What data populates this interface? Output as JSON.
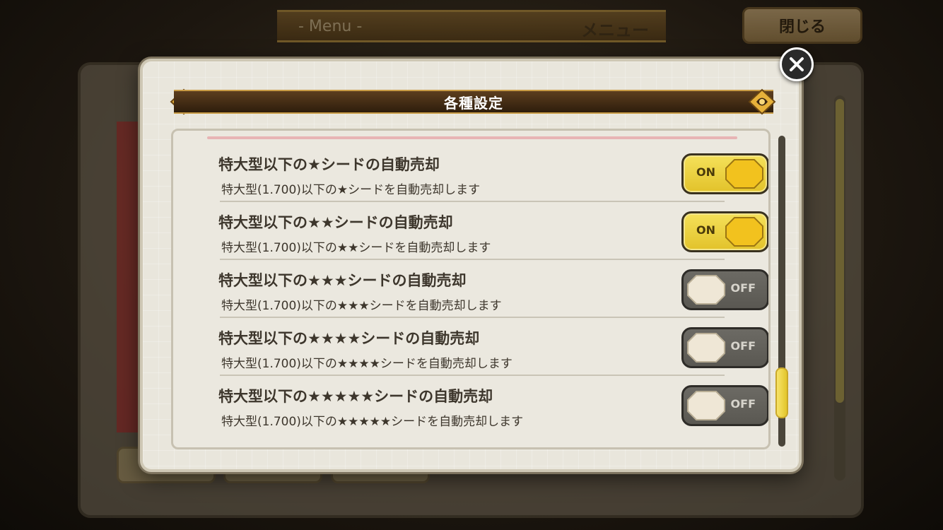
{
  "background": {
    "header_en": "- Menu -",
    "header_jp": "メニュー",
    "close_button_label": "閉じる"
  },
  "dialog": {
    "title": "各種設定",
    "close_icon": "close-icon",
    "settings": [
      {
        "title": "特大型以下の★シードの自動売却",
        "description": "特大型(1.700)以下の★シードを自動売却します",
        "state": "ON"
      },
      {
        "title": "特大型以下の★★シードの自動売却",
        "description": "特大型(1.700)以下の★★シードを自動売却します",
        "state": "ON"
      },
      {
        "title": "特大型以下の★★★シードの自動売却",
        "description": "特大型(1.700)以下の★★★シードを自動売却します",
        "state": "OFF"
      },
      {
        "title": "特大型以下の★★★★シードの自動売却",
        "description": "特大型(1.700)以下の★★★★シードを自動売却します",
        "state": "OFF"
      },
      {
        "title": "特大型以下の★★★★★シードの自動売却",
        "description": "特大型(1.700)以下の★★★★★シードを自動売却します",
        "state": "OFF"
      }
    ]
  },
  "colors": {
    "toggle_on": "#f0d840",
    "toggle_off": "#636159",
    "title_bar": "#3d2912",
    "panel_bg": "#e9e6dc"
  }
}
